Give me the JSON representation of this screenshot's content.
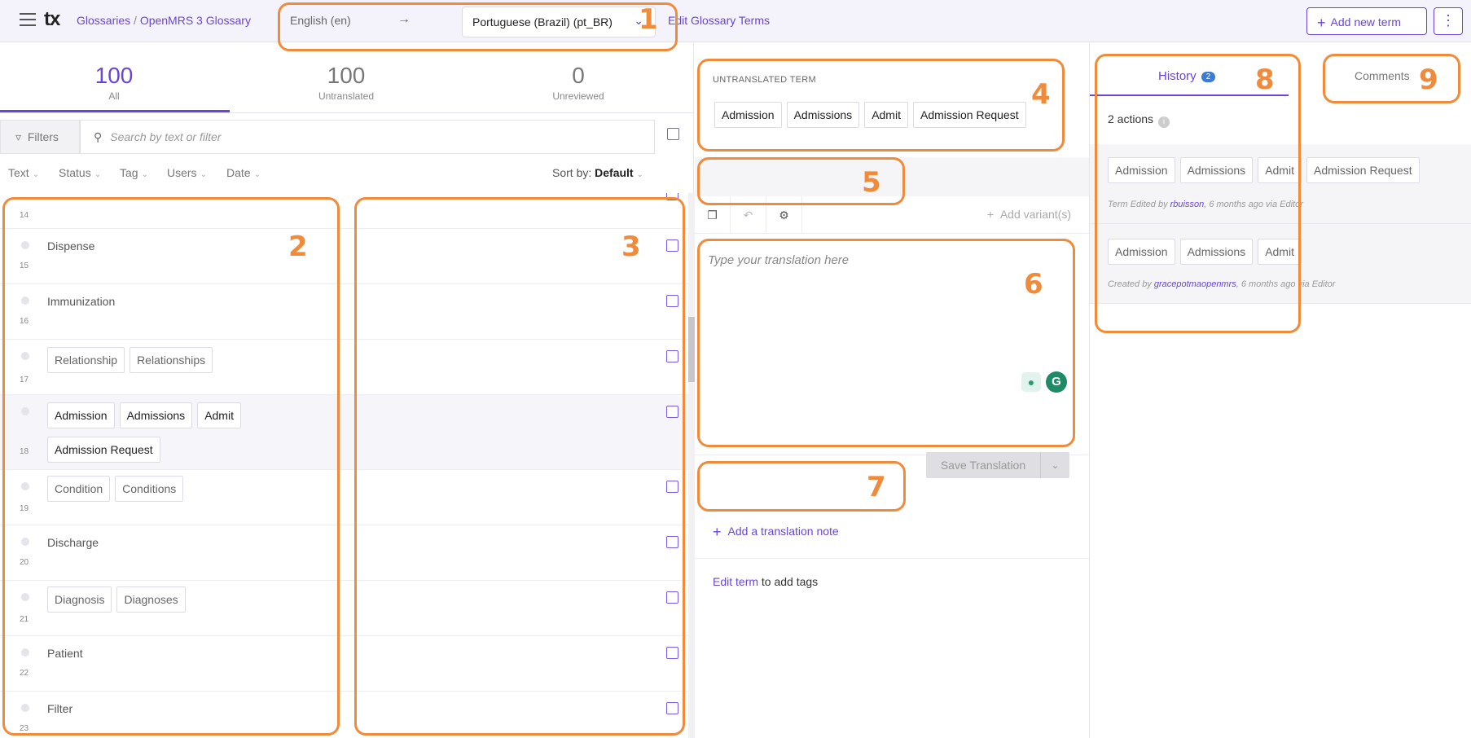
{
  "header": {
    "breadcrumb_root": "Glossaries",
    "breadcrumb_sep": " / ",
    "breadcrumb_current": "OpenMRS 3 Glossary",
    "source_language": "English (en)",
    "arrow": "→",
    "target_language": "Portuguese (Brazil) (pt_BR)",
    "edit_glossary": "Edit Glossary Terms",
    "add_new_term": "Add new term"
  },
  "counters": [
    {
      "count": "100",
      "label": "All"
    },
    {
      "count": "100",
      "label": "Untranslated"
    },
    {
      "count": "0",
      "label": "Unreviewed"
    }
  ],
  "filters": {
    "button": "Filters",
    "search_placeholder": "Search by text or filter",
    "dropdowns": [
      "Text",
      "Status",
      "Tag",
      "Users",
      "Date"
    ],
    "sort_prefix": "Sort by:",
    "sort_value": "Default"
  },
  "rows": [
    {
      "index": "14",
      "terms": []
    },
    {
      "index": "15",
      "term": "Dispense"
    },
    {
      "index": "16",
      "term": "Immunization"
    },
    {
      "index": "17",
      "terms": [
        "Relationship",
        "Relationships"
      ]
    },
    {
      "index": "18",
      "terms": [
        "Admission",
        "Admissions",
        "Admit"
      ],
      "terms2": [
        "Admission Request"
      ]
    },
    {
      "index": "19",
      "terms": [
        "Condition",
        "Conditions"
      ]
    },
    {
      "index": "20",
      "term": "Discharge"
    },
    {
      "index": "21",
      "terms": [
        "Diagnosis",
        "Diagnoses"
      ]
    },
    {
      "index": "22",
      "term": "Patient"
    },
    {
      "index": "23",
      "term": "Filter"
    }
  ],
  "editor": {
    "untranslated_label": "UNTRANSLATED TERM",
    "untranslated_terms": [
      "Admission",
      "Admissions",
      "Admit",
      "Admission Request"
    ],
    "add_variants": "Add variant(s)",
    "translation_placeholder": "Type your translation here",
    "save_translation": "Save Translation",
    "add_note": "Add a translation note",
    "edit_term_link": "Edit term",
    "edit_term_suffix": " to add tags"
  },
  "history": {
    "tab_label": "History",
    "tab_count": "2",
    "comments_label": "Comments",
    "actions_count": "2 actions",
    "entries": [
      {
        "terms": [
          "Admission",
          "Admissions",
          "Admit",
          "Admission Request"
        ],
        "meta_prefix": "Term Edited by ",
        "user": "rbuisson",
        "meta_suffix": ", 6 months ago via Editor"
      },
      {
        "terms": [
          "Admission",
          "Admissions",
          "Admit"
        ],
        "meta_prefix": "Created by ",
        "user": "gracepotmaopenmrs",
        "meta_suffix": ", 6 months ago via Editor"
      }
    ]
  },
  "annotations": [
    "1",
    "2",
    "3",
    "4",
    "5",
    "6",
    "7",
    "8",
    "9"
  ],
  "colors": {
    "accent": "#6a45d8",
    "annotation": "#ef8b3a",
    "topbar": "#f4f2fb"
  }
}
